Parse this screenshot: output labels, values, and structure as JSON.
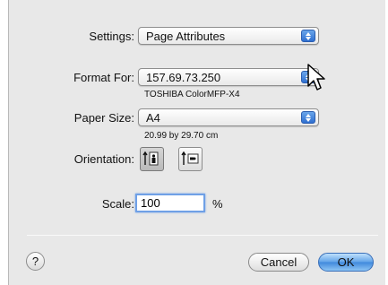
{
  "settings": {
    "label": "Settings:",
    "value": "Page Attributes"
  },
  "format_for": {
    "label": "Format For:",
    "value": "157.69.73.250",
    "printer": "TOSHIBA ColorMFP-X4"
  },
  "paper_size": {
    "label": "Paper Size:",
    "value": "A4",
    "dimensions": "20.99 by 29.70 cm"
  },
  "orientation": {
    "label": "Orientation:",
    "selected": "portrait"
  },
  "scale": {
    "label": "Scale:",
    "value": "100",
    "unit": "%"
  },
  "buttons": {
    "help": "?",
    "cancel": "Cancel",
    "ok": "OK"
  },
  "colors": {
    "accent": "#4a90e2",
    "dialog_bg": "#e8e8e8"
  }
}
